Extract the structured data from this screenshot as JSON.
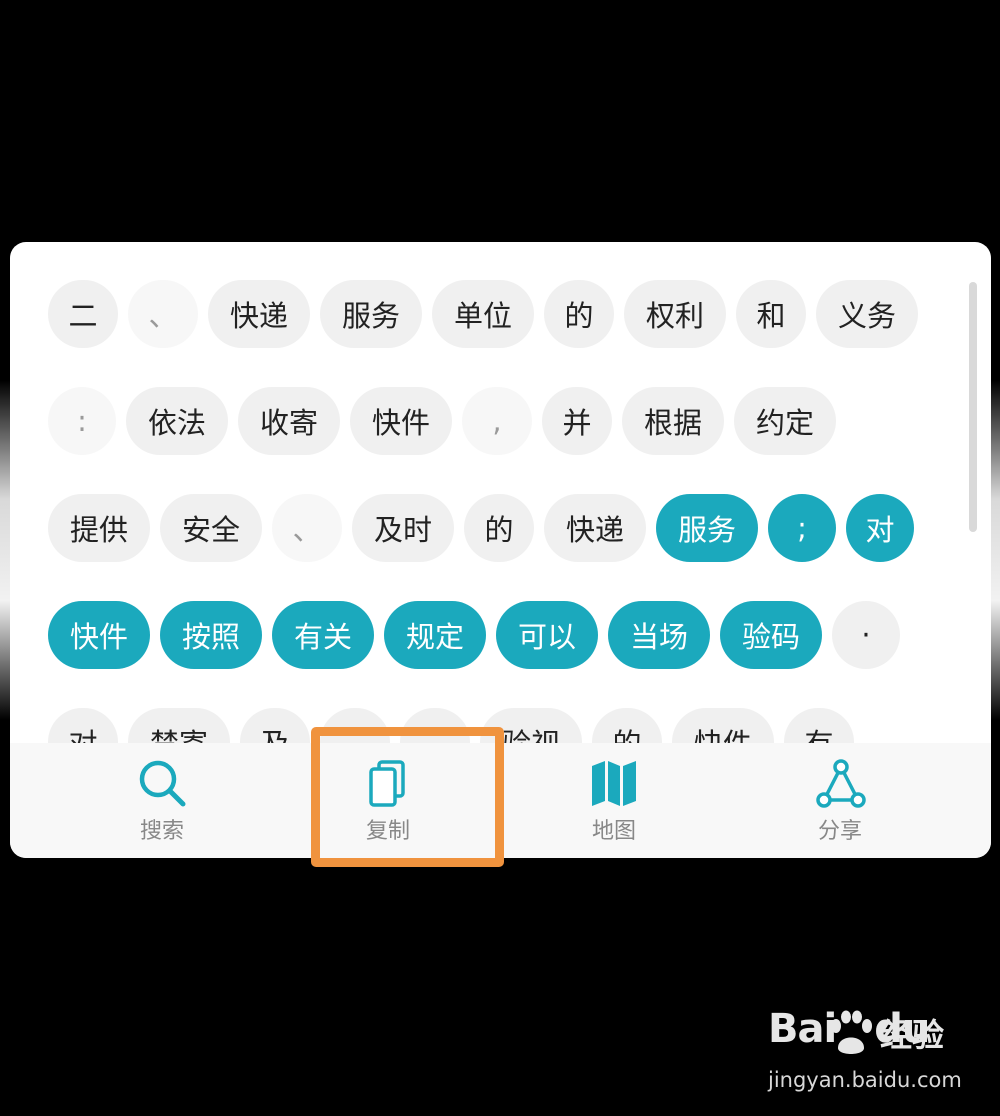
{
  "colors": {
    "accent": "#1ba9bd",
    "chip_bg": "#f0f0f0",
    "highlight_box": "#f0933e"
  },
  "rows": [
    [
      {
        "text": "二",
        "state": "normal"
      },
      {
        "text": "、",
        "state": "faint"
      },
      {
        "text": "快递",
        "state": "normal"
      },
      {
        "text": "服务",
        "state": "normal"
      },
      {
        "text": "单位",
        "state": "normal"
      },
      {
        "text": "的",
        "state": "normal"
      },
      {
        "text": "权利",
        "state": "normal"
      },
      {
        "text": "和",
        "state": "normal"
      },
      {
        "text": "义务",
        "state": "normal"
      }
    ],
    [
      {
        "text": ":",
        "state": "faint"
      },
      {
        "text": "依法",
        "state": "normal"
      },
      {
        "text": "收寄",
        "state": "normal"
      },
      {
        "text": "快件",
        "state": "normal"
      },
      {
        "text": ",",
        "state": "faint"
      },
      {
        "text": "并",
        "state": "normal"
      },
      {
        "text": "根据",
        "state": "normal"
      },
      {
        "text": "约定",
        "state": "normal"
      }
    ],
    [
      {
        "text": "提供",
        "state": "normal"
      },
      {
        "text": "安全",
        "state": "normal"
      },
      {
        "text": "、",
        "state": "faint"
      },
      {
        "text": "及时",
        "state": "normal"
      },
      {
        "text": "的",
        "state": "normal"
      },
      {
        "text": "快递",
        "state": "normal"
      },
      {
        "text": "服务",
        "state": "selected"
      },
      {
        "text": ";",
        "state": "selected"
      },
      {
        "text": "对",
        "state": "selected"
      }
    ],
    [
      {
        "text": "快件",
        "state": "selected"
      },
      {
        "text": "按照",
        "state": "selected"
      },
      {
        "text": "有关",
        "state": "selected"
      },
      {
        "text": "规定",
        "state": "selected"
      },
      {
        "text": "可以",
        "state": "selected"
      },
      {
        "text": "当场",
        "state": "selected"
      },
      {
        "text": "验码",
        "state": "selected"
      },
      {
        "text": "·",
        "state": "normal"
      }
    ],
    [
      {
        "text": "对",
        "state": "normal"
      },
      {
        "text": "禁寄",
        "state": "normal"
      },
      {
        "text": "及",
        "state": "normal"
      },
      {
        "text": "",
        "state": "normal"
      },
      {
        "text": "",
        "state": "normal"
      },
      {
        "text": "验视",
        "state": "normal"
      },
      {
        "text": "的",
        "state": "normal"
      },
      {
        "text": "快件",
        "state": "normal"
      },
      {
        "text": "有",
        "state": "normal"
      }
    ]
  ],
  "toolbar": {
    "search": {
      "label": "搜索",
      "icon": "search-icon"
    },
    "copy": {
      "label": "复制",
      "icon": "copy-icon"
    },
    "map": {
      "label": "地图",
      "icon": "map-icon"
    },
    "share": {
      "label": "分享",
      "icon": "share-icon"
    }
  },
  "watermark": {
    "logo": "Bai",
    "logo_tail": "du",
    "text": "经验",
    "url": "jingyan.baidu.com"
  }
}
